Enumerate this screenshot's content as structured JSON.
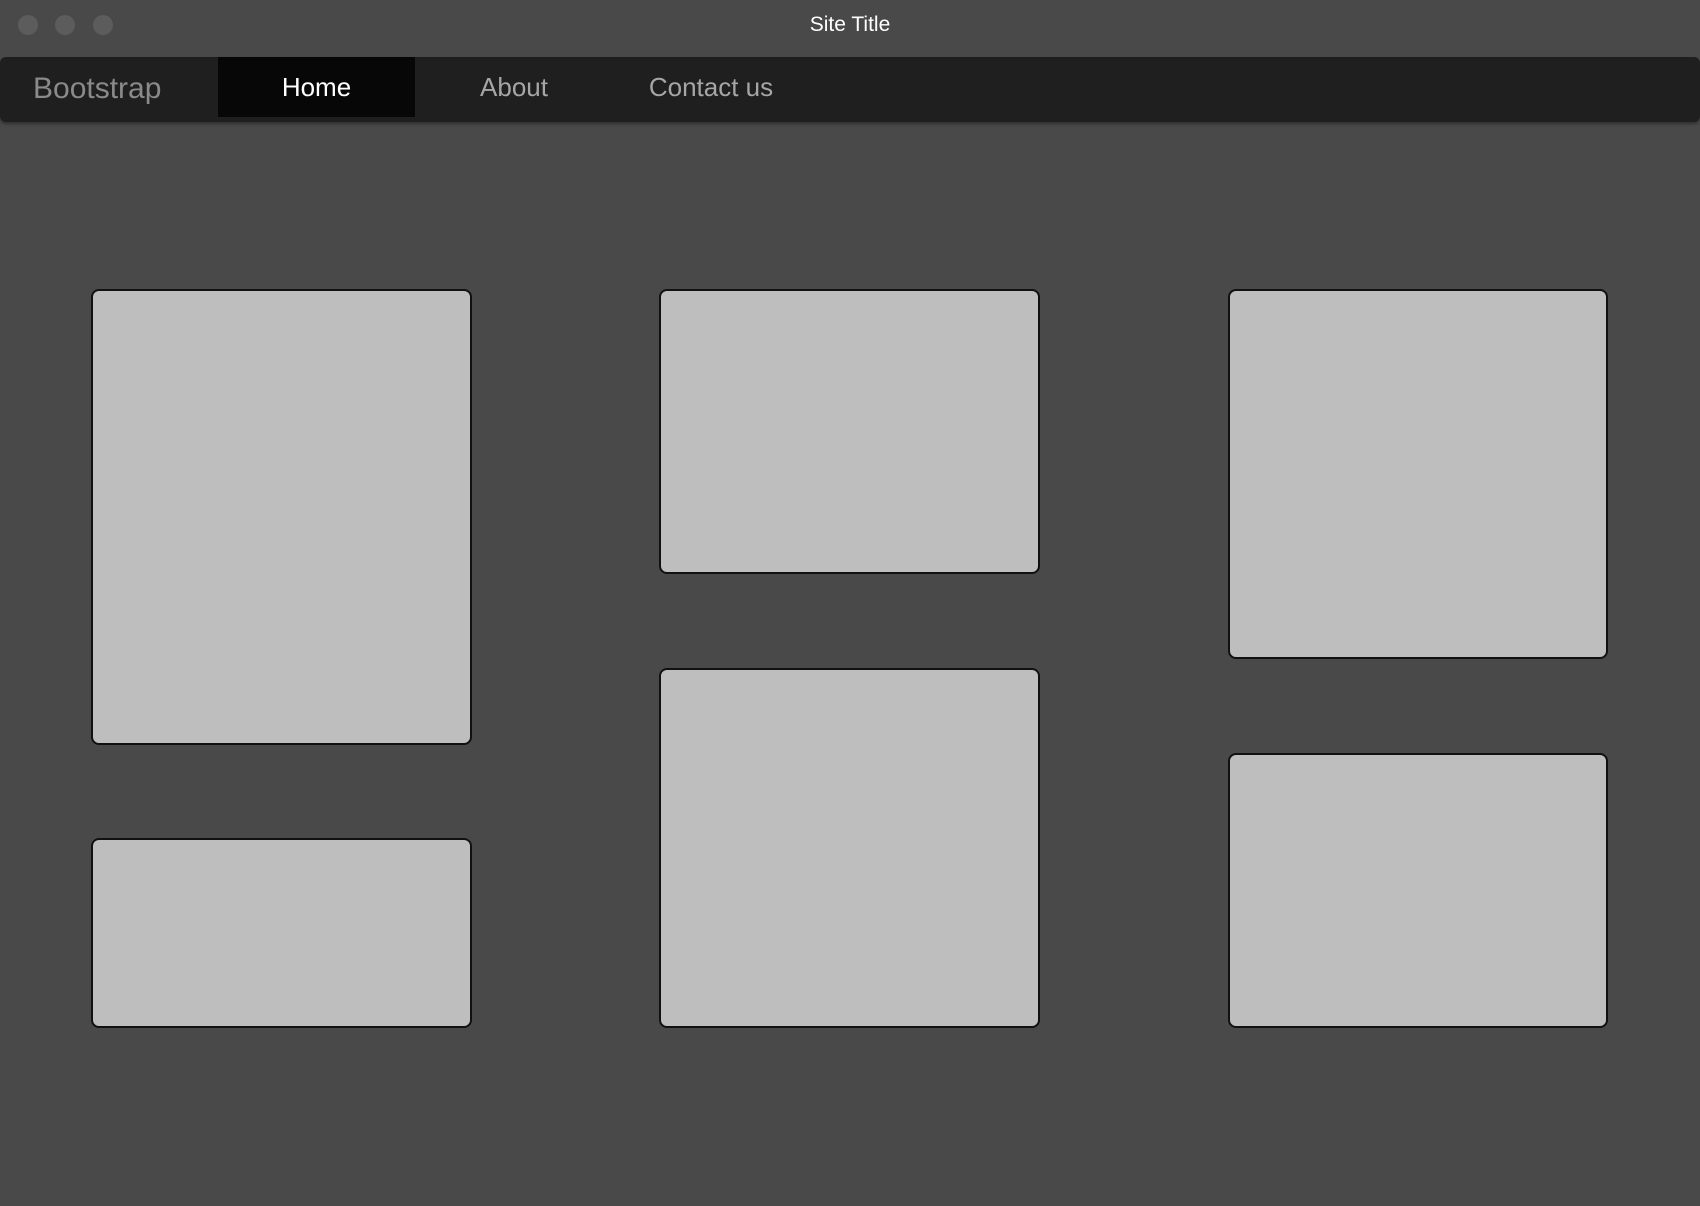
{
  "window": {
    "title": "Site Title"
  },
  "navbar": {
    "brand": "Bootstrap",
    "items": [
      {
        "label": "Home",
        "active": true
      },
      {
        "label": "About",
        "active": false
      },
      {
        "label": "Contact us",
        "active": false
      }
    ]
  },
  "colors": {
    "background": "#494949",
    "navbar": "#1f1f1f",
    "active_nav": "#070707",
    "card": "#bebebe",
    "card_border": "#111111"
  }
}
